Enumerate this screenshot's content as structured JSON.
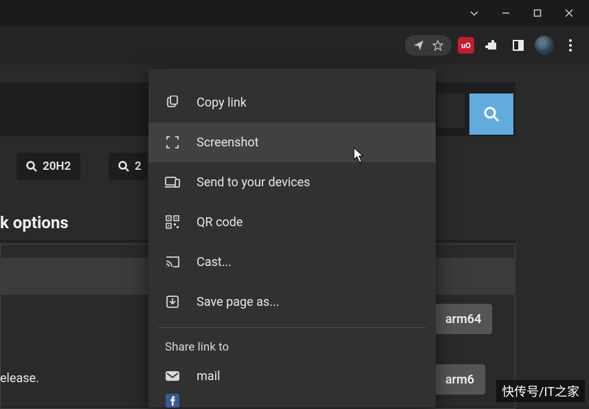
{
  "window_controls": {
    "dropdown": "⌄",
    "minimize": "—",
    "maximize": "▢",
    "close": "✕"
  },
  "toolbar": {
    "ublock_label": "uO",
    "menu_glyph": "⋮"
  },
  "filters": {
    "chip1": "20H2",
    "chip2": "2"
  },
  "section_title": "k options",
  "release_text": "elease.",
  "arm_btn_1": "arm64",
  "arm_btn_2": "arm6",
  "share_menu": {
    "items": [
      {
        "label": "Copy link"
      },
      {
        "label": "Screenshot"
      },
      {
        "label": "Send to your devices"
      },
      {
        "label": "QR code"
      },
      {
        "label": "Cast..."
      },
      {
        "label": "Save page as..."
      }
    ],
    "share_header": "Share link to",
    "share_targets": [
      {
        "label": "mail"
      }
    ]
  },
  "watermark": "快传号/IT之家"
}
